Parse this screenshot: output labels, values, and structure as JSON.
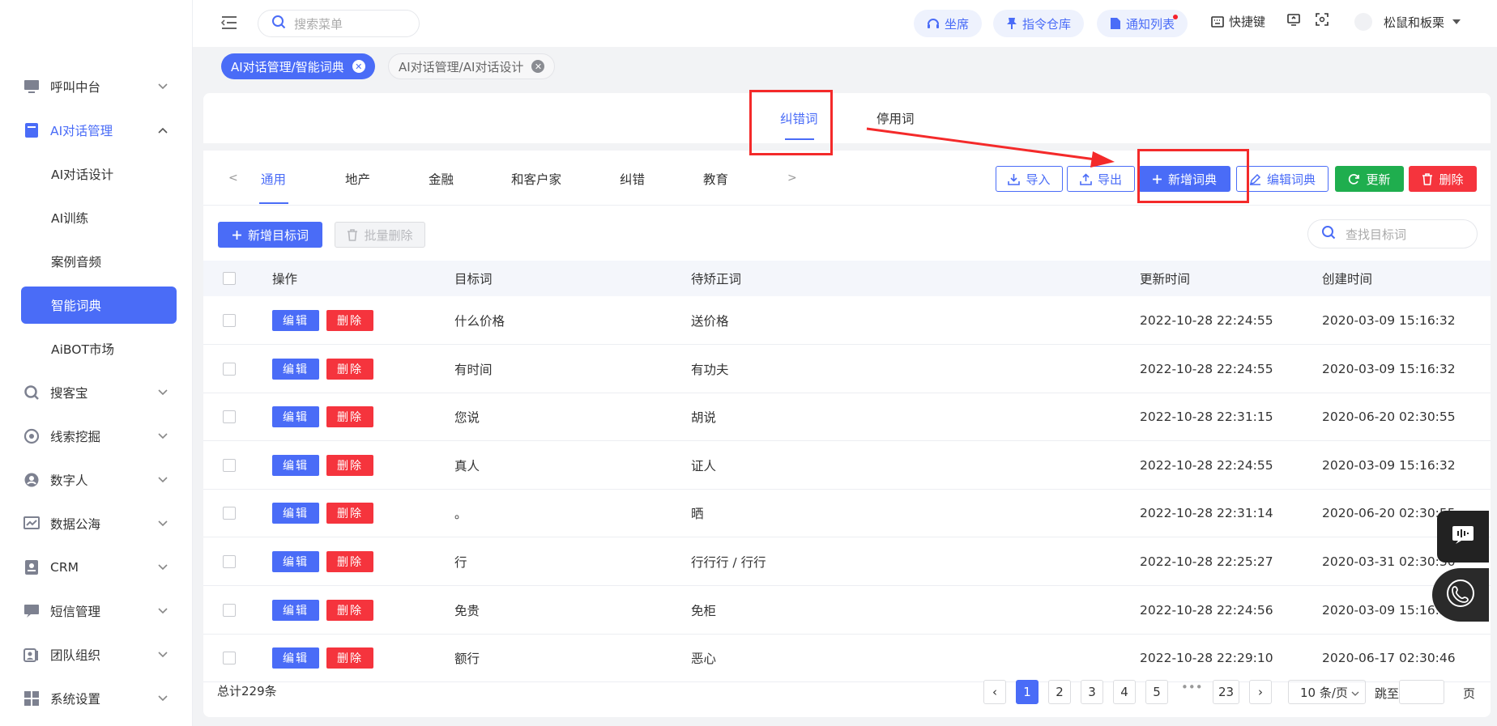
{
  "header": {
    "search_placeholder": "搜索菜单",
    "pills": [
      "坐席",
      "指令仓库",
      "通知列表"
    ],
    "shortcut_label": "快捷键",
    "user_name": "松鼠和板栗"
  },
  "sidebar": {
    "items": [
      {
        "label": "呼叫中台",
        "icon": "monitor-icon"
      },
      {
        "label": "AI对话管理",
        "icon": "book-icon",
        "expanded": true
      },
      {
        "label": "搜客宝",
        "icon": "magnifier-icon"
      },
      {
        "label": "线索挖掘",
        "icon": "target-icon"
      },
      {
        "label": "数字人",
        "icon": "robot-icon"
      },
      {
        "label": "数据公海",
        "icon": "chart-icon"
      },
      {
        "label": "CRM",
        "icon": "contact-icon"
      },
      {
        "label": "短信管理",
        "icon": "message-icon"
      },
      {
        "label": "团队组织",
        "icon": "team-icon"
      },
      {
        "label": "系统设置",
        "icon": "settings-icon"
      }
    ],
    "sub_items": [
      "AI对话设计",
      "AI训练",
      "案例音频",
      "智能词典",
      "AiBOT市场"
    ],
    "selected_sub": "智能词典"
  },
  "page_tabs": [
    {
      "label": "AI对话管理/智能词典",
      "active": true
    },
    {
      "label": "AI对话管理/AI对话设计",
      "active": false
    }
  ],
  "main_tabs": [
    "纠错词",
    "停用词"
  ],
  "categories": [
    "通用",
    "地产",
    "金融",
    "和客户家",
    "纠错",
    "教育"
  ],
  "toolbar": {
    "import": "导入",
    "export": "导出",
    "add_dict": "新增词典",
    "edit_dict": "编辑词典",
    "refresh": "更新",
    "delete": "删除"
  },
  "actions": {
    "add_target": "新增目标词",
    "batch_delete": "批量删除",
    "search_placeholder": "查找目标词"
  },
  "table": {
    "columns": [
      "操作",
      "目标词",
      "待矫正词",
      "更新时间",
      "创建时间"
    ],
    "edit_label": "编辑",
    "delete_label": "删除",
    "rows": [
      {
        "target": "什么价格",
        "correct": "送价格",
        "updated": "2022-10-28 22:24:55",
        "created": "2020-03-09 15:16:32"
      },
      {
        "target": "有时间",
        "correct": "有功夫",
        "updated": "2022-10-28 22:24:55",
        "created": "2020-03-09 15:16:32"
      },
      {
        "target": "您说",
        "correct": "胡说",
        "updated": "2022-10-28 22:31:15",
        "created": "2020-06-20 02:30:55"
      },
      {
        "target": "真人",
        "correct": "证人",
        "updated": "2022-10-28 22:24:55",
        "created": "2020-03-09 15:16:32"
      },
      {
        "target": "。",
        "correct": "晒",
        "updated": "2022-10-28 22:31:14",
        "created": "2020-06-20 02:30:55"
      },
      {
        "target": "行",
        "correct": "行行行 / 行行",
        "updated": "2022-10-28 22:25:27",
        "created": "2020-03-31 02:30:30"
      },
      {
        "target": "免贵",
        "correct": "免柜",
        "updated": "2022-10-28 22:24:56",
        "created": "2020-03-09 15:16:32"
      },
      {
        "target": "额行",
        "correct": "恶心",
        "updated": "2022-10-28 22:29:10",
        "created": "2020-06-17 02:30:46"
      }
    ]
  },
  "pagination": {
    "total": "总计229条",
    "pages": [
      "1",
      "2",
      "3",
      "4",
      "5"
    ],
    "ellipsis": "•••",
    "last": "23",
    "page_size": "10 条/页",
    "jump_label": "跳至",
    "page_suffix": "页"
  },
  "colors": {
    "primary": "#4a6cf7",
    "danger": "#f5343d",
    "success": "#1fae4e",
    "annotation": "#f42a2a"
  }
}
